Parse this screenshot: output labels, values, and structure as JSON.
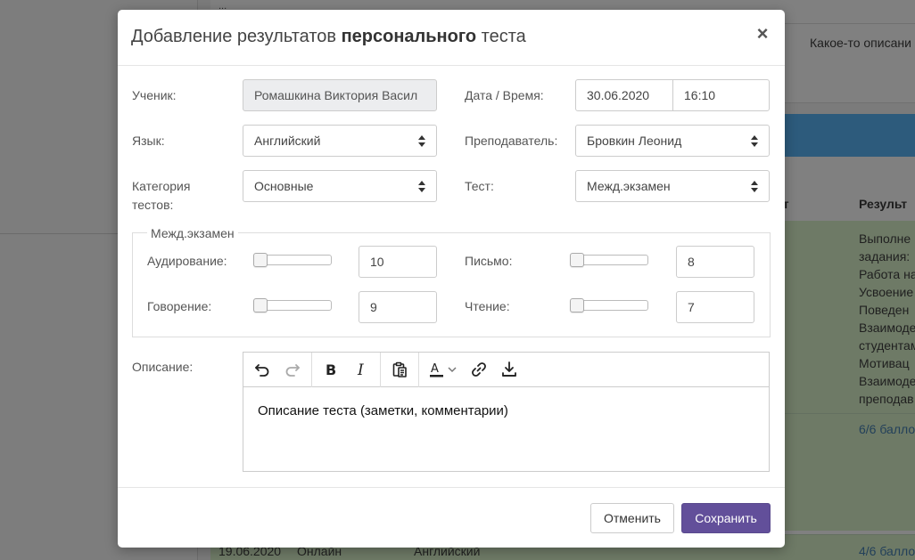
{
  "background": {
    "top_text": "...",
    "description": "Какое-то описани",
    "table_headers": [
      "ст",
      "Результ"
    ],
    "results_lines": [
      "Выполне",
      "задания:",
      "Работа на",
      "Усвоение",
      "Поведен",
      "Взаимоде",
      "студентам",
      "Мотивац",
      "Взаимоде",
      "преподав"
    ],
    "scores": [
      "6/6 балло",
      "4/6 балло"
    ],
    "last_row": {
      "date": "19.06.2020",
      "format": "Онлайн",
      "language": "Английский"
    }
  },
  "modal": {
    "title_prefix": "Добавление результатов ",
    "title_bold": "персонального",
    "title_suffix": " теста",
    "close_label": "×",
    "fields": {
      "student_label": "Ученик:",
      "student_value": "Ромашкина Виктория Васил",
      "datetime_label": "Дата / Время:",
      "date_value": "30.06.2020",
      "time_value": "16:10",
      "language_label": "Язык:",
      "language_value": "Английский",
      "teacher_label": "Преподаватель:",
      "teacher_value": "Бровкин Леонид",
      "category_label": "Категория тестов:",
      "category_value": "Основные",
      "test_label": "Тест:",
      "test_value": "Межд.экзамен"
    },
    "scores_group": {
      "legend": "Межд.экзамен",
      "items": [
        {
          "label": "Аудирование:",
          "value": "10",
          "slider_level": 0
        },
        {
          "label": "Письмо:",
          "value": "8",
          "slider_level": 0
        },
        {
          "label": "Говорение:",
          "value": "9",
          "slider_level": 0
        },
        {
          "label": "Чтение:",
          "value": "7",
          "slider_level": 0
        }
      ]
    },
    "description": {
      "label": "Описание:",
      "text": "Описание теста (заметки, комментарии)",
      "toolbar": [
        "undo-icon",
        "redo-icon",
        "bold-icon",
        "italic-icon",
        "paste-icon",
        "font-color-icon",
        "link-icon",
        "download-icon"
      ]
    },
    "footer": {
      "cancel_label": "Отменить",
      "save_label": "Сохранить"
    }
  },
  "colors": {
    "primary": "#624f9a",
    "overlay": "#7b7b7b"
  }
}
